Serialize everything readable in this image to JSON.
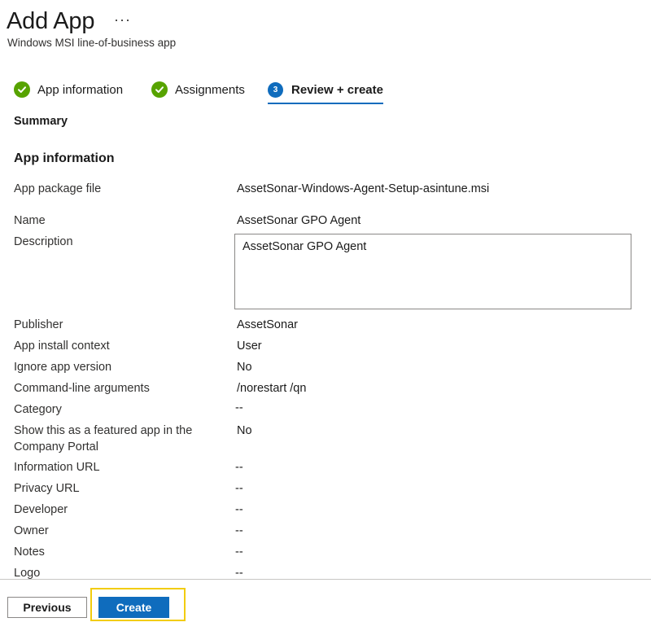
{
  "header": {
    "title": "Add App",
    "more_icon": "···",
    "subtitle": "Windows MSI line-of-business app"
  },
  "tabs": [
    {
      "label": "App information",
      "state": "complete",
      "icon": "checkmark-circle-icon"
    },
    {
      "label": "Assignments",
      "state": "complete",
      "icon": "checkmark-circle-icon"
    },
    {
      "label": "Review + create",
      "state": "active",
      "step": "3"
    }
  ],
  "summary_heading": "Summary",
  "app_info_heading": "App information",
  "fields": {
    "package_file": {
      "label": "App package file",
      "value": "AssetSonar-Windows-Agent-Setup-asintune.msi"
    },
    "name": {
      "label": "Name",
      "value": "AssetSonar GPO Agent"
    },
    "description": {
      "label": "Description",
      "value": "AssetSonar GPO Agent"
    },
    "publisher": {
      "label": "Publisher",
      "value": "AssetSonar"
    },
    "install_context": {
      "label": "App install context",
      "value": "User"
    },
    "ignore_version": {
      "label": "Ignore app version",
      "value": "No"
    },
    "cmd_args": {
      "label": "Command-line arguments",
      "value": "/norestart /qn"
    },
    "category": {
      "label": "Category",
      "value": "--"
    },
    "featured": {
      "label": "Show this as a featured app in the Company Portal",
      "value": "No"
    },
    "info_url": {
      "label": "Information URL",
      "value": "--"
    },
    "privacy_url": {
      "label": "Privacy URL",
      "value": "--"
    },
    "developer": {
      "label": "Developer",
      "value": "--"
    },
    "owner": {
      "label": "Owner",
      "value": "--"
    },
    "notes": {
      "label": "Notes",
      "value": "--"
    },
    "logo": {
      "label": "Logo",
      "value": "--"
    }
  },
  "footer": {
    "previous_label": "Previous",
    "create_label": "Create"
  },
  "colors": {
    "accent": "#0f6cbd",
    "success": "#57a300",
    "highlight": "#f2cc0c"
  }
}
